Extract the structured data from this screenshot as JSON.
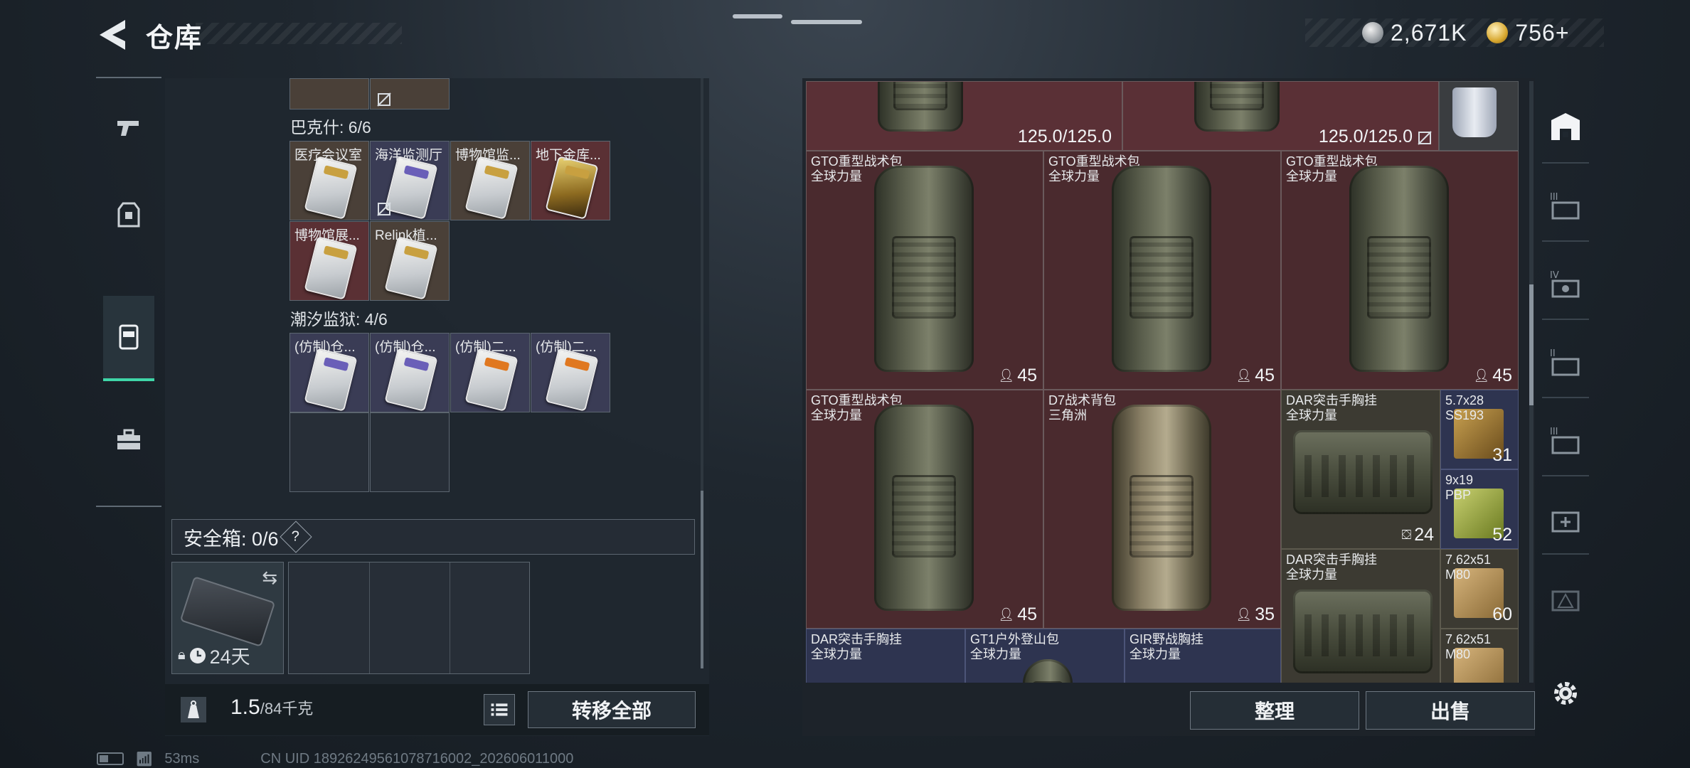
{
  "header": {
    "title": "仓库",
    "currencies": [
      {
        "icon": "silver-coin-icon",
        "value": "2,671K"
      },
      {
        "icon": "gold-coin-icon",
        "value": "756+"
      }
    ]
  },
  "left_rail": {
    "items": [
      {
        "name": "weapons",
        "icon": "pistol-icon",
        "active": false
      },
      {
        "name": "armor",
        "icon": "vest-icon",
        "active": false
      },
      {
        "name": "keycards",
        "icon": "keycard-icon",
        "active": true
      },
      {
        "name": "toolbox",
        "icon": "toolbox-icon",
        "active": false
      }
    ]
  },
  "key_groups": [
    {
      "label": "巴克什: 6/6",
      "cells": [
        {
          "label": "医疗会议室",
          "bg": "brown",
          "variant": "gold-band",
          "locked": false
        },
        {
          "label": "海洋监测厅",
          "bg": "blue",
          "variant": "purple-band",
          "locked": true
        },
        {
          "label": "博物馆监...",
          "bg": "brown",
          "variant": "gold-band",
          "locked": false
        },
        {
          "label": "地下金库...",
          "bg": "red",
          "variant": "gold-card",
          "locked": false
        },
        {
          "label": "博物馆展...",
          "bg": "red",
          "variant": "gold-band",
          "locked": false
        },
        {
          "label": "Relink植...",
          "bg": "brown",
          "variant": "gold-band",
          "locked": false
        }
      ]
    },
    {
      "label": "潮汐监狱: 4/6",
      "cells": [
        {
          "label": "(仿制)仓...",
          "bg": "blue",
          "variant": "purple-band",
          "locked": false
        },
        {
          "label": "(仿制)仓...",
          "bg": "blue",
          "variant": "purple-band",
          "locked": false
        },
        {
          "label": "(仿制)二...",
          "bg": "blue",
          "variant": "orange-band",
          "locked": false
        },
        {
          "label": "(仿制)二...",
          "bg": "blue",
          "variant": "orange-band",
          "locked": false
        }
      ]
    }
  ],
  "safebox": {
    "label": "安全箱: 0/6",
    "help": "?",
    "days": "24天"
  },
  "footer_left": {
    "weight_value": "1.5",
    "weight_capacity": "/84千克",
    "transfer_all": "转移全部"
  },
  "stash": {
    "top_row": [
      {
        "durability": "125.0/125.0"
      },
      {
        "durability": "125.0/125.0"
      }
    ],
    "items": [
      {
        "name": "GTO重型战术包",
        "sub": "全球力量",
        "count": "45",
        "kind": "bag"
      },
      {
        "name": "GTO重型战术包",
        "sub": "全球力量",
        "count": "45",
        "kind": "bag"
      },
      {
        "name": "GTO重型战术包",
        "sub": "全球力量",
        "count": "45",
        "kind": "bag"
      },
      {
        "name": "GTO重型战术包",
        "sub": "全球力量",
        "count": "45",
        "kind": "bag"
      },
      {
        "name": "D7战术背包",
        "sub": "三角洲",
        "count": "35",
        "kind": "bag-tan"
      },
      {
        "name": "DAR突击手胸挂",
        "sub": "全球力量",
        "count": "24",
        "kind": "rig"
      },
      {
        "name": "DAR突击手胸挂",
        "sub": "全球力量",
        "count": "",
        "kind": "rig"
      },
      {
        "name": "DAR突击手胸挂",
        "sub": "全球力量",
        "count": "",
        "kind": "rig"
      },
      {
        "name": "GT1户外登山包",
        "sub": "全球力量",
        "count": "",
        "kind": "bag"
      },
      {
        "name": "GIR野战胸挂",
        "sub": "全球力量",
        "count": "",
        "kind": "rig"
      }
    ],
    "ammo": [
      {
        "name": "5.7x28",
        "sub": "SS193",
        "count": "31"
      },
      {
        "name": "9x19",
        "sub": "PBP",
        "count": "52"
      },
      {
        "name": "7.62x51",
        "sub": "M80",
        "count": "60"
      },
      {
        "name": "7.62x51",
        "sub": "M80",
        "count": ""
      }
    ]
  },
  "actions": {
    "sort": "整理",
    "sell": "出售"
  },
  "storage_rail": {
    "items": [
      {
        "icon": "home-storage-icon"
      },
      {
        "icon": "storage-3-icon"
      },
      {
        "icon": "storage-4-icon"
      },
      {
        "icon": "storage-5-icon"
      },
      {
        "icon": "storage-6-icon"
      },
      {
        "icon": "storage-add-icon"
      },
      {
        "icon": "storage-locked-icon"
      }
    ]
  },
  "status_bar": {
    "ping": "53ms",
    "uid": "CN UID 18926249561078716002_202606011000"
  }
}
